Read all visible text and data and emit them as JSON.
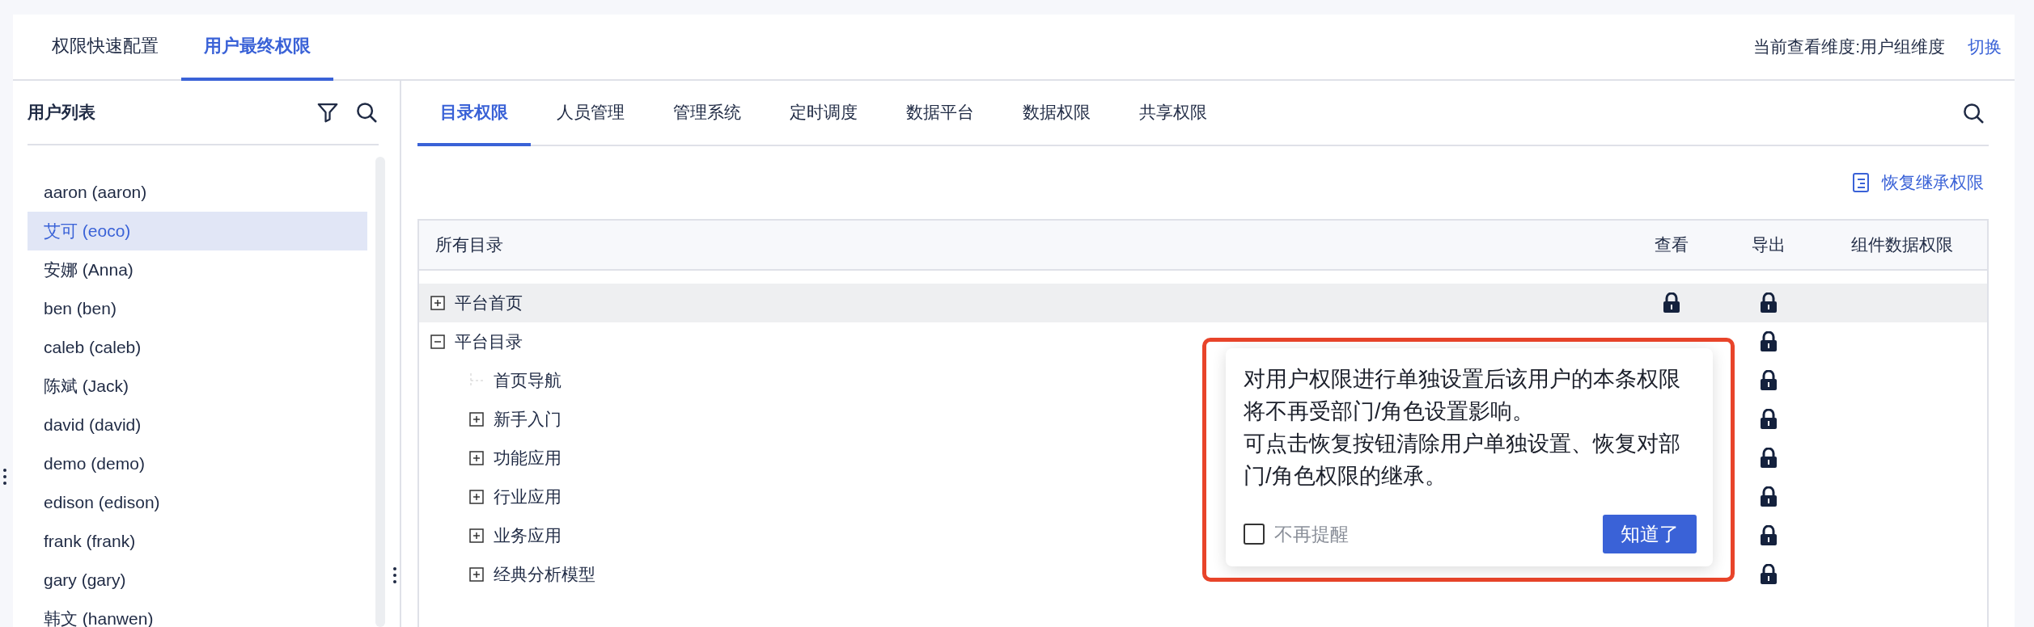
{
  "top_tabs": [
    {
      "label": "权限快速配置",
      "selected": false
    },
    {
      "label": "用户最终权限",
      "selected": true
    }
  ],
  "dimension": {
    "label": "当前查看维度:用户组维度",
    "switch": "切换"
  },
  "user_list": {
    "title": "用户列表",
    "users": [
      {
        "name": "aaron (aaron)",
        "selected": false
      },
      {
        "name": "艾可 (eoco)",
        "selected": true
      },
      {
        "name": "安娜 (Anna)",
        "selected": false
      },
      {
        "name": "ben (ben)",
        "selected": false
      },
      {
        "name": "caleb (caleb)",
        "selected": false
      },
      {
        "name": "陈斌 (Jack)",
        "selected": false
      },
      {
        "name": "david (david)",
        "selected": false
      },
      {
        "name": "demo (demo)",
        "selected": false
      },
      {
        "name": "edison (edison)",
        "selected": false
      },
      {
        "name": "frank (frank)",
        "selected": false
      },
      {
        "name": "gary (gary)",
        "selected": false
      },
      {
        "name": "韩文 (hanwen)",
        "selected": false
      }
    ]
  },
  "perm_tabs": [
    {
      "label": "目录权限",
      "selected": true
    },
    {
      "label": "人员管理",
      "selected": false
    },
    {
      "label": "管理系统",
      "selected": false
    },
    {
      "label": "定时调度",
      "selected": false
    },
    {
      "label": "数据平台",
      "selected": false
    },
    {
      "label": "数据权限",
      "selected": false
    },
    {
      "label": "共享权限",
      "selected": false
    }
  ],
  "restore_button": "恢复继承权限",
  "table": {
    "columns": [
      "所有目录",
      "查看",
      "导出",
      "组件数据权限"
    ],
    "rows": [
      {
        "name": "平台首页",
        "expanded": false,
        "highlighted": true,
        "view_lock": true,
        "export_lock": true,
        "children": []
      },
      {
        "name": "平台目录",
        "expanded": true,
        "highlighted": false,
        "export_lock": true,
        "children": [
          {
            "name": "首页导航",
            "export_lock": true
          },
          {
            "name": "新手入门",
            "expanded": false,
            "export_lock": true
          },
          {
            "name": "功能应用",
            "expanded": false,
            "export_lock": true
          },
          {
            "name": "行业应用",
            "expanded": false,
            "export_lock": true
          },
          {
            "name": "业务应用",
            "expanded": false,
            "export_lock": true
          },
          {
            "name": "经典分析模型",
            "expanded": false,
            "export_lock": true
          }
        ]
      }
    ]
  },
  "popup": {
    "message": "对用户权限进行单独设置后该用户的本条权限将不再受部门/角色设置影响。",
    "message_2": "可点击恢复按钮清除用户单独设置、恢复对部门/角色权限的继承。",
    "checkbox": {
      "label": "不再提醒",
      "checked": false
    },
    "button": "知道了"
  }
}
